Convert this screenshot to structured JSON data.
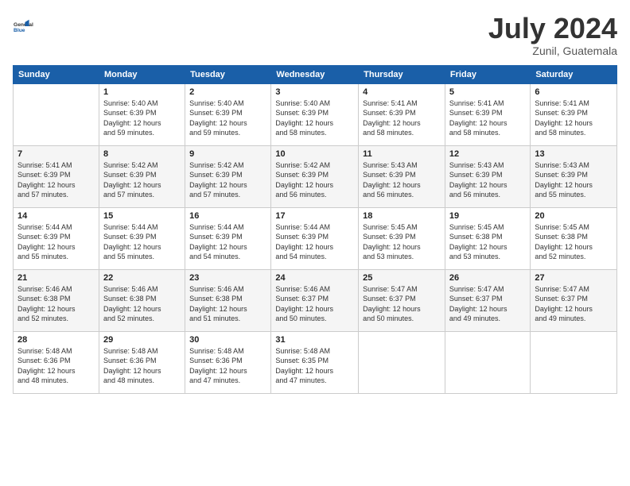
{
  "header": {
    "logo_line1": "General",
    "logo_line2": "Blue",
    "month": "July 2024",
    "location": "Zunil, Guatemala"
  },
  "days_of_week": [
    "Sunday",
    "Monday",
    "Tuesday",
    "Wednesday",
    "Thursday",
    "Friday",
    "Saturday"
  ],
  "weeks": [
    [
      {
        "day": "",
        "info": ""
      },
      {
        "day": "1",
        "info": "Sunrise: 5:40 AM\nSunset: 6:39 PM\nDaylight: 12 hours\nand 59 minutes."
      },
      {
        "day": "2",
        "info": "Sunrise: 5:40 AM\nSunset: 6:39 PM\nDaylight: 12 hours\nand 59 minutes."
      },
      {
        "day": "3",
        "info": "Sunrise: 5:40 AM\nSunset: 6:39 PM\nDaylight: 12 hours\nand 58 minutes."
      },
      {
        "day": "4",
        "info": "Sunrise: 5:41 AM\nSunset: 6:39 PM\nDaylight: 12 hours\nand 58 minutes."
      },
      {
        "day": "5",
        "info": "Sunrise: 5:41 AM\nSunset: 6:39 PM\nDaylight: 12 hours\nand 58 minutes."
      },
      {
        "day": "6",
        "info": "Sunrise: 5:41 AM\nSunset: 6:39 PM\nDaylight: 12 hours\nand 58 minutes."
      }
    ],
    [
      {
        "day": "7",
        "info": "Sunrise: 5:41 AM\nSunset: 6:39 PM\nDaylight: 12 hours\nand 57 minutes."
      },
      {
        "day": "8",
        "info": "Sunrise: 5:42 AM\nSunset: 6:39 PM\nDaylight: 12 hours\nand 57 minutes."
      },
      {
        "day": "9",
        "info": "Sunrise: 5:42 AM\nSunset: 6:39 PM\nDaylight: 12 hours\nand 57 minutes."
      },
      {
        "day": "10",
        "info": "Sunrise: 5:42 AM\nSunset: 6:39 PM\nDaylight: 12 hours\nand 56 minutes."
      },
      {
        "day": "11",
        "info": "Sunrise: 5:43 AM\nSunset: 6:39 PM\nDaylight: 12 hours\nand 56 minutes."
      },
      {
        "day": "12",
        "info": "Sunrise: 5:43 AM\nSunset: 6:39 PM\nDaylight: 12 hours\nand 56 minutes."
      },
      {
        "day": "13",
        "info": "Sunrise: 5:43 AM\nSunset: 6:39 PM\nDaylight: 12 hours\nand 55 minutes."
      }
    ],
    [
      {
        "day": "14",
        "info": "Sunrise: 5:44 AM\nSunset: 6:39 PM\nDaylight: 12 hours\nand 55 minutes."
      },
      {
        "day": "15",
        "info": "Sunrise: 5:44 AM\nSunset: 6:39 PM\nDaylight: 12 hours\nand 55 minutes."
      },
      {
        "day": "16",
        "info": "Sunrise: 5:44 AM\nSunset: 6:39 PM\nDaylight: 12 hours\nand 54 minutes."
      },
      {
        "day": "17",
        "info": "Sunrise: 5:44 AM\nSunset: 6:39 PM\nDaylight: 12 hours\nand 54 minutes."
      },
      {
        "day": "18",
        "info": "Sunrise: 5:45 AM\nSunset: 6:39 PM\nDaylight: 12 hours\nand 53 minutes."
      },
      {
        "day": "19",
        "info": "Sunrise: 5:45 AM\nSunset: 6:38 PM\nDaylight: 12 hours\nand 53 minutes."
      },
      {
        "day": "20",
        "info": "Sunrise: 5:45 AM\nSunset: 6:38 PM\nDaylight: 12 hours\nand 52 minutes."
      }
    ],
    [
      {
        "day": "21",
        "info": "Sunrise: 5:46 AM\nSunset: 6:38 PM\nDaylight: 12 hours\nand 52 minutes."
      },
      {
        "day": "22",
        "info": "Sunrise: 5:46 AM\nSunset: 6:38 PM\nDaylight: 12 hours\nand 52 minutes."
      },
      {
        "day": "23",
        "info": "Sunrise: 5:46 AM\nSunset: 6:38 PM\nDaylight: 12 hours\nand 51 minutes."
      },
      {
        "day": "24",
        "info": "Sunrise: 5:46 AM\nSunset: 6:37 PM\nDaylight: 12 hours\nand 50 minutes."
      },
      {
        "day": "25",
        "info": "Sunrise: 5:47 AM\nSunset: 6:37 PM\nDaylight: 12 hours\nand 50 minutes."
      },
      {
        "day": "26",
        "info": "Sunrise: 5:47 AM\nSunset: 6:37 PM\nDaylight: 12 hours\nand 49 minutes."
      },
      {
        "day": "27",
        "info": "Sunrise: 5:47 AM\nSunset: 6:37 PM\nDaylight: 12 hours\nand 49 minutes."
      }
    ],
    [
      {
        "day": "28",
        "info": "Sunrise: 5:48 AM\nSunset: 6:36 PM\nDaylight: 12 hours\nand 48 minutes."
      },
      {
        "day": "29",
        "info": "Sunrise: 5:48 AM\nSunset: 6:36 PM\nDaylight: 12 hours\nand 48 minutes."
      },
      {
        "day": "30",
        "info": "Sunrise: 5:48 AM\nSunset: 6:36 PM\nDaylight: 12 hours\nand 47 minutes."
      },
      {
        "day": "31",
        "info": "Sunrise: 5:48 AM\nSunset: 6:35 PM\nDaylight: 12 hours\nand 47 minutes."
      },
      {
        "day": "",
        "info": ""
      },
      {
        "day": "",
        "info": ""
      },
      {
        "day": "",
        "info": ""
      }
    ]
  ]
}
